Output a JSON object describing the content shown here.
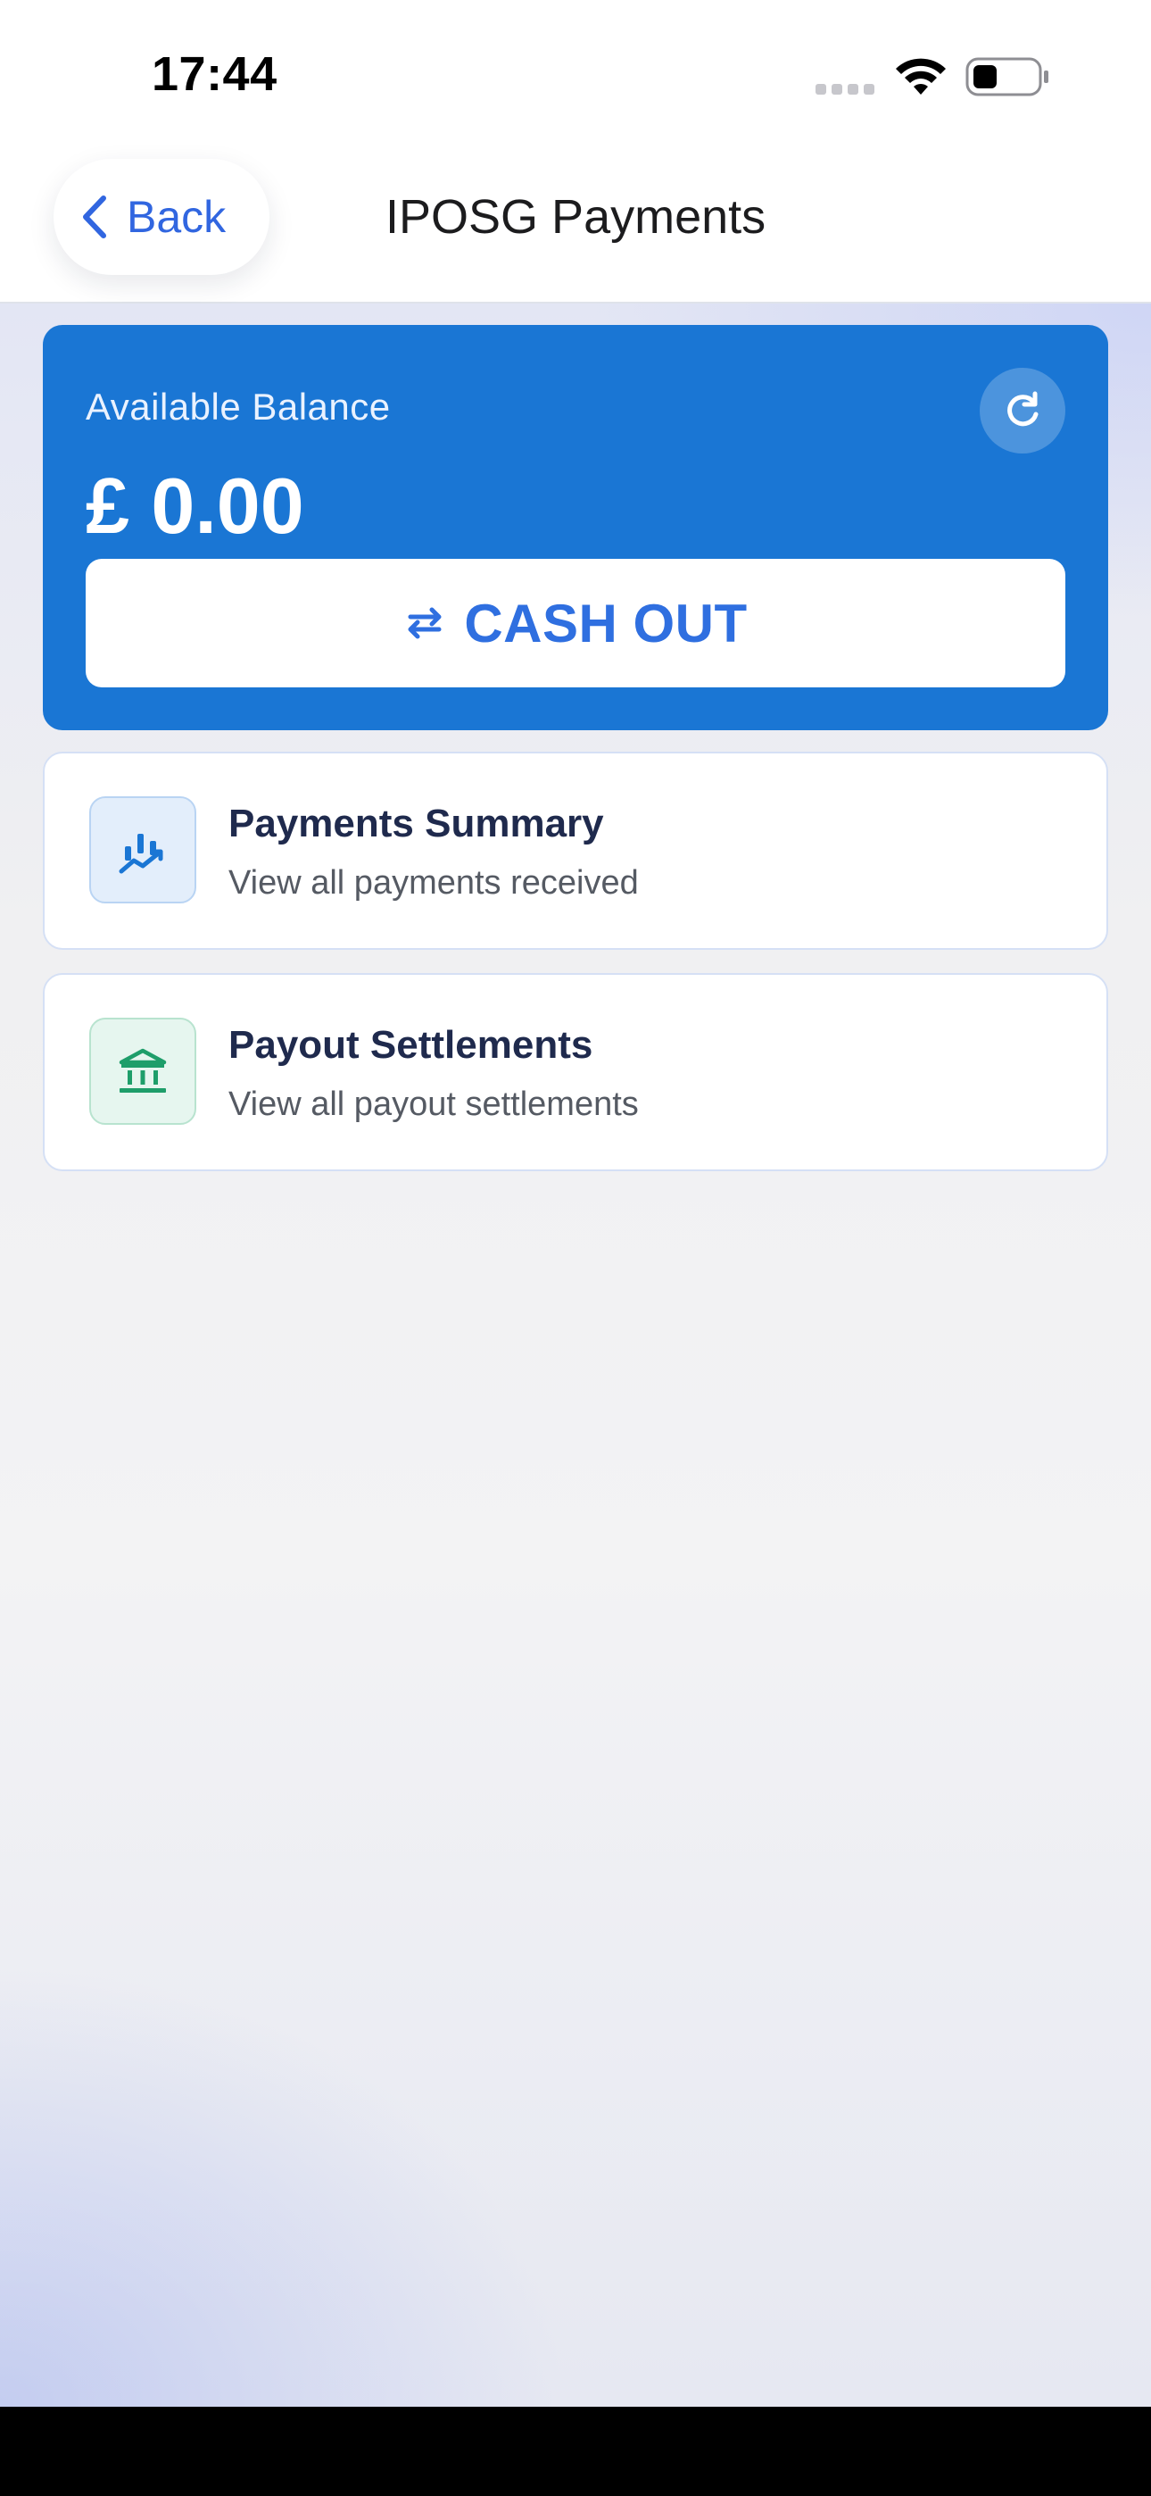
{
  "status_bar": {
    "time": "17:44",
    "icons": [
      "signal-dots-icon",
      "wifi-icon",
      "battery-icon"
    ]
  },
  "nav": {
    "back_label": "Back",
    "title": "IPOSG Payments",
    "icons": [
      "chevron-left-icon"
    ]
  },
  "balance_card": {
    "label": "Available Balance",
    "amount": "£ 0.00",
    "refresh_icon": "refresh-icon",
    "cashout_label": "CASH OUT",
    "cashout_icon": "swap-arrows-icon",
    "background_color": "#1a76d4"
  },
  "menu": [
    {
      "title": "Payments Summary",
      "subtitle": "View all payments received",
      "icon": "chart-trend-icon",
      "accent_color": "#1a76d4"
    },
    {
      "title": "Payout Settlements",
      "subtitle": "View all payout settlements",
      "icon": "bank-icon",
      "accent_color": "#1e9e6a"
    }
  ],
  "colors": {
    "accent": "#3166e0",
    "title_text": "#1f2a4d",
    "subtitle_text": "#555a63"
  }
}
